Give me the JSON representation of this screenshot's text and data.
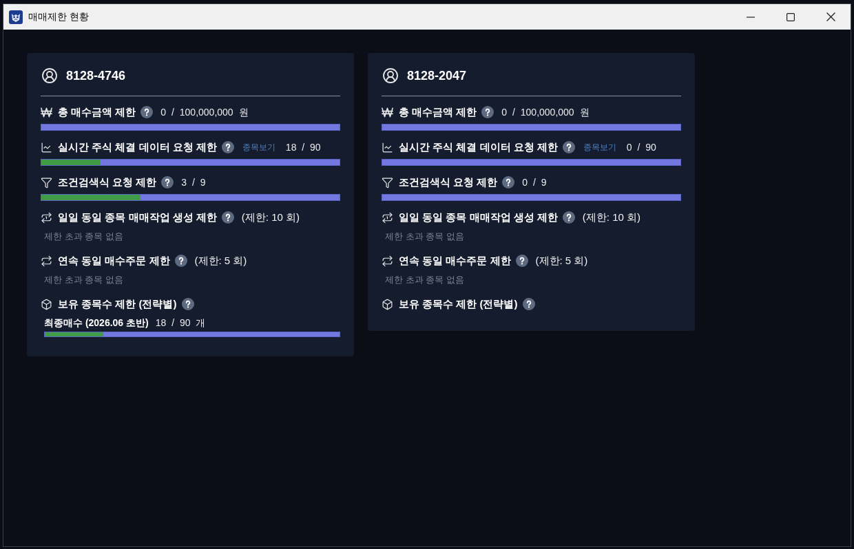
{
  "window": {
    "title": "매매제한 현황"
  },
  "accounts": [
    {
      "account": "8128-4746",
      "limits": [
        {
          "kind": "amount",
          "label": "총 매수금액 제한",
          "reading": "0 / 100,000,000 원",
          "level": 0
        },
        {
          "kind": "stream",
          "label": "실시간 주식 체결 데이터 요청 제한",
          "link": "종목보기",
          "reading": "18 / 90",
          "level": 0.2
        },
        {
          "kind": "filter",
          "label": "조건검색식 요청 제한",
          "reading": "3 / 9",
          "level": 0.333
        },
        {
          "kind": "daily",
          "label": "일일 동일 종목 매매작업 생성 제한",
          "reading": "(제한: 10 회)",
          "note": "제한 초과 종목 없음"
        },
        {
          "kind": "repeat",
          "label": "연속 동일 매수주문 제한",
          "reading": "(제한: 5 회)",
          "note": "제한 초과 종목 없음"
        },
        {
          "kind": "holdings",
          "label": "보유 종목수 제한 (전략별)",
          "strategies": [
            {
              "name": "최종매수 (2026.06 초반)",
              "reading": "18 / 90 개",
              "level": 0.2
            }
          ]
        }
      ]
    },
    {
      "account": "8128-2047",
      "limits": [
        {
          "kind": "amount",
          "label": "총 매수금액 제한",
          "reading": "0 / 100,000,000 원",
          "level": 0
        },
        {
          "kind": "stream",
          "label": "실시간 주식 체결 데이터 요청 제한",
          "link": "종목보기",
          "reading": "0 / 90",
          "level": 0
        },
        {
          "kind": "filter",
          "label": "조건검색식 요청 제한",
          "reading": "0 / 9",
          "level": 0
        },
        {
          "kind": "daily",
          "label": "일일 동일 종목 매매작업 생성 제한",
          "reading": "(제한: 10 회)",
          "note": "제한 초과 종목 없음"
        },
        {
          "kind": "repeat",
          "label": "연속 동일 매수주문 제한",
          "reading": "(제한: 5 회)",
          "note": "제한 초과 종목 없음"
        },
        {
          "kind": "holdings",
          "label": "보유 종목수 제한 (전략별)"
        }
      ]
    }
  ]
}
